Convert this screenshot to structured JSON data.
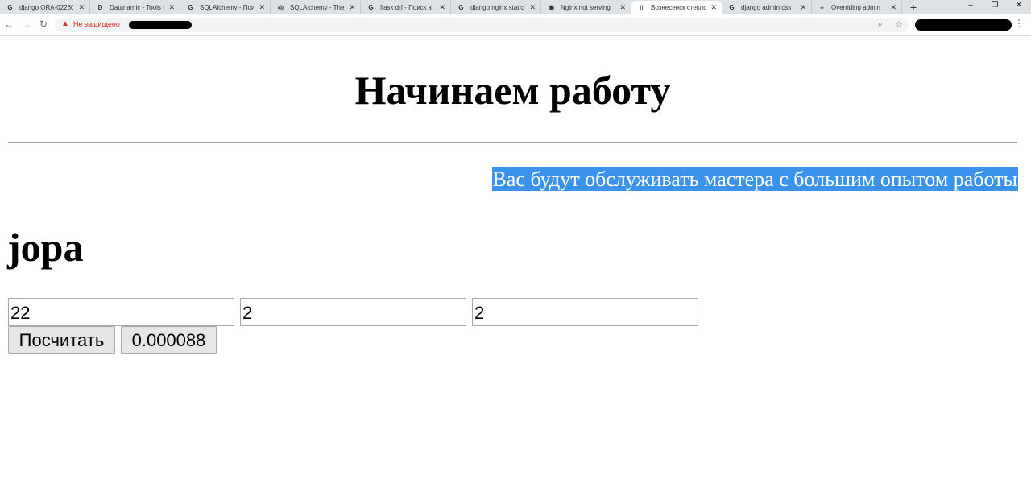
{
  "browser": {
    "tabs": [
      {
        "icon": "google-icon",
        "fav": "G",
        "title": "django ORA-02260",
        "close": "✕",
        "active": false
      },
      {
        "icon": "datanamic-icon",
        "fav": "D",
        "title": "Datanamic - Tools f",
        "close": "✕",
        "active": false
      },
      {
        "icon": "google-icon",
        "fav": "G",
        "title": "SQLAlchemy - Пои",
        "close": "✕",
        "active": false
      },
      {
        "icon": "sqlalchemy-icon",
        "fav": "◎",
        "title": "SQLAlchemy - The",
        "close": "✕",
        "active": false
      },
      {
        "icon": "google-icon",
        "fav": "G",
        "title": "flask drf - Поиск в",
        "close": "✕",
        "active": false
      },
      {
        "icon": "google-icon",
        "fav": "G",
        "title": "django nginx static",
        "close": "✕",
        "active": false
      },
      {
        "icon": "globe-icon",
        "fav": "◉",
        "title": "Nginx not serving",
        "close": "✕",
        "active": false
      },
      {
        "icon": "page-icon",
        "fav": "▯",
        "title": "Вознесенск стекло",
        "close": "✕",
        "active": true
      },
      {
        "icon": "google-icon",
        "fav": "G",
        "title": "django admin css",
        "close": "✕",
        "active": false
      },
      {
        "icon": "stackoverflow-icon",
        "fav": "≡",
        "title": "Overriding admin",
        "close": "✕",
        "active": false
      }
    ],
    "new_tab": "+",
    "window_controls": {
      "minimize": "–",
      "restore": "❐",
      "close": "✕"
    },
    "nav": {
      "back": "←",
      "forward": "→",
      "reload": "↻"
    },
    "address": {
      "warning_icon": "▲",
      "security_label": "Не защищено"
    },
    "zoom_icon": "⌕",
    "star_icon": "☆",
    "menu_icon": "⋮"
  },
  "page": {
    "title": "Начинаем работу",
    "promo": "Вас будут обслуживать мастера с большим опытом работы",
    "heading": "jopa",
    "inputs": {
      "a": "22",
      "b": "2",
      "c": "2"
    },
    "calculate_label": "Посчитать",
    "result_label": "0.000088"
  }
}
